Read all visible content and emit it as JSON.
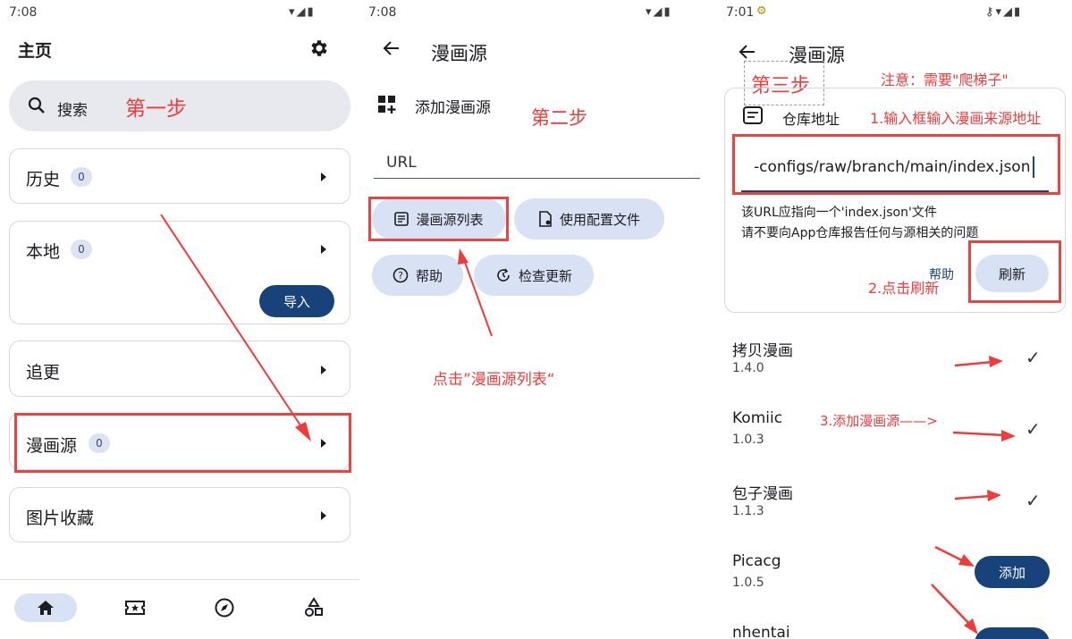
{
  "panel1": {
    "status_time": "7:08",
    "title": "主页",
    "search_placeholder": "搜索",
    "step_note": "第一步",
    "items": [
      {
        "label": "历史",
        "badge": "0"
      },
      {
        "label": "本地",
        "badge": "0",
        "button": "导入"
      },
      {
        "label": "追更"
      },
      {
        "label": "漫画源",
        "badge": "0"
      },
      {
        "label": "图片收藏"
      }
    ],
    "nav": [
      "home-icon",
      "ticket-icon",
      "explore-icon",
      "category-icon"
    ]
  },
  "panel2": {
    "status_time": "7:08",
    "title": "漫画源",
    "add_label": "添加漫画源",
    "step_note": "第二步",
    "url_label": "URL",
    "btn_list": "漫画源列表",
    "btn_config": "使用配置文件",
    "btn_help": "帮助",
    "btn_update": "检查更新",
    "click_note": "点击”漫画源列表“"
  },
  "panel3": {
    "status_time": "7:01",
    "title": "漫画源",
    "step_note": "第三步",
    "warning_note": "注意：需要\"爬梯子\"",
    "repo_label": "仓库地址",
    "input_note": "1.输入框输入漫画来源地址",
    "url_value": "-configs/raw/branch/main/index.json",
    "hint1": "该URL应指向一个'index.json'文件",
    "hint2": "请不要向App仓库报告任何与源相关的问题",
    "help_link": "帮助",
    "refresh_note": "2.点击刷新",
    "refresh_btn": "刷新",
    "add_note": "3.添加漫画源——>",
    "sources": [
      {
        "name": "拷贝漫画",
        "version": "1.4.0",
        "state": "added"
      },
      {
        "name": "Komiic",
        "version": "1.0.3",
        "state": "added"
      },
      {
        "name": "包子漫画",
        "version": "1.1.3",
        "state": "added"
      },
      {
        "name": "Picacg",
        "version": "1.0.5",
        "state": "add",
        "button": "添加"
      },
      {
        "name": "nhentai",
        "version": "",
        "state": "add",
        "button": ""
      }
    ]
  },
  "colors": {
    "annotation_red": "#ef3b3b",
    "primary_button": "#17437a",
    "tonal_button": "#d9e2f5",
    "search_bg": "#e8e9ee"
  }
}
